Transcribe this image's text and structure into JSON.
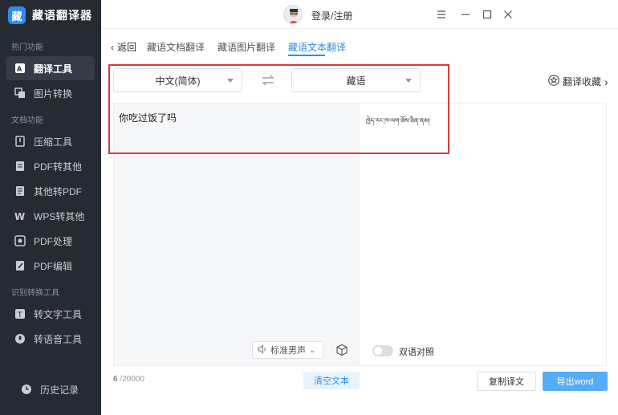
{
  "app": {
    "logo_char": "藏",
    "title": "藏语翻译器"
  },
  "sidebar": {
    "sections": [
      {
        "title": "热门功能"
      },
      {
        "title": "文档功能"
      },
      {
        "title": "识别转换工具"
      }
    ],
    "items": [
      {
        "label": "翻译工具",
        "icon": "translate-icon",
        "active": true
      },
      {
        "label": "图片转换",
        "icon": "image-convert-icon"
      },
      {
        "label": "压缩工具",
        "icon": "compress-icon"
      },
      {
        "label": "PDF转其他",
        "icon": "pdf-icon"
      },
      {
        "label": "其他转PDF",
        "icon": "file-to-pdf-icon"
      },
      {
        "label": "WPS转其他",
        "icon": "wps-icon"
      },
      {
        "label": "PDF处理",
        "icon": "pdf-process-icon"
      },
      {
        "label": "PDF编辑",
        "icon": "pdf-edit-icon"
      },
      {
        "label": "转文字工具",
        "icon": "text-icon"
      },
      {
        "label": "转语音工具",
        "icon": "voice-icon"
      }
    ],
    "history": "历史记录"
  },
  "topbar": {
    "login": "登录/注册"
  },
  "tabs": {
    "back": "返回",
    "items": [
      "藏语文档翻译",
      "藏语图片翻译",
      "藏语文本翻译"
    ]
  },
  "lang": {
    "source": "中文(简体)",
    "target": "藏语"
  },
  "favorites": "翻译收藏",
  "source_text": "你吃过饭了吗",
  "target_text": "ཁྱེད་རང་ཁ་ལག་ཟོས་ཟིན་ནམ།",
  "voice_label": "标准男声",
  "bilingual_label": "双语对照",
  "count": {
    "current": "6",
    "max": "/20000"
  },
  "buttons": {
    "clear": "清空文本",
    "copy": "复制译文",
    "export": "导出word"
  },
  "colors": {
    "accent": "#2d8cf0",
    "sidebar_bg": "#252a33",
    "highlight": "#d43c3c"
  }
}
